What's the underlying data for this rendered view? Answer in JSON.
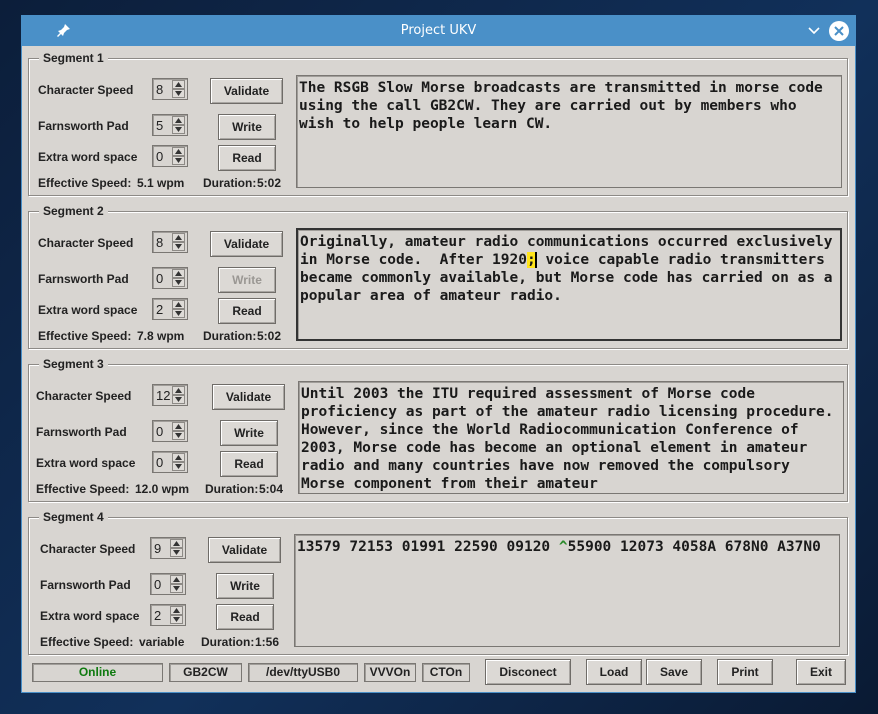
{
  "window": {
    "title": "Project UKV"
  },
  "labels": {
    "character_speed": "Character Speed",
    "farnsworth_pad": "Farnsworth Pad",
    "extra_word_space": "Extra word space",
    "effective_speed": "Effective Speed:",
    "duration": "Duration:",
    "validate": "Validate",
    "write": "Write",
    "read": "Read"
  },
  "segments": [
    {
      "title": "Segment 1",
      "character_speed": "8",
      "farnsworth_pad": "5",
      "extra_word_space": "0",
      "effective_speed": "5.1 wpm",
      "duration": "5:02",
      "text": "The RSGB Slow Morse broadcasts are transmitted in morse code using the call GB2CW. They are carried out by members who wish to help people learn CW."
    },
    {
      "title": "Segment 2",
      "character_speed": "8",
      "farnsworth_pad": "0",
      "extra_word_space": "2",
      "effective_speed": "7.8 wpm",
      "duration": "5:02",
      "text_before": "Originally, amateur radio communications occurred exclusively in Morse code.  After 1920",
      "text_highlight": ";",
      "text_after": " voice capable radio transmitters became commonly available, but Morse code has carried on as a popular area of amateur radio."
    },
    {
      "title": "Segment 3",
      "character_speed": "12",
      "farnsworth_pad": "0",
      "extra_word_space": "0",
      "effective_speed": "12.0 wpm",
      "duration": "5:04",
      "text": "Until 2003 the ITU required assessment of Morse code proficiency as part of the amateur radio licensing procedure.  However, since the World Radiocommunication Conference of 2003, Morse code has become an optional element in amateur radio and many countries have now removed the compulsory Morse component from their amateur"
    },
    {
      "title": "Segment 4",
      "character_speed": "9",
      "farnsworth_pad": "0",
      "extra_word_space": "2",
      "effective_speed": "variable",
      "duration": "1:56",
      "text_before": "13579 72153 01991 22590 09120 ",
      "text_mark": "^",
      "text_after": "55900 12073 4058A 678N0 A37N0"
    }
  ],
  "statusbar": {
    "connection": "Online",
    "callsign": "GB2CW",
    "port": "/dev/ttyUSB0",
    "vvv": "VVVOn",
    "cto": "CTOn",
    "disconnect": "Disconect",
    "load": "Load",
    "save": "Save",
    "print": "Print",
    "exit": "Exit"
  },
  "colors": {
    "titlebar": "#4a90c8",
    "online": "#0f7a0f",
    "highlight": "#ffe41a"
  },
  "icons": [
    "pin-icon",
    "chevron-down-icon",
    "close-icon",
    "spin-up-icon",
    "spin-down-icon"
  ]
}
